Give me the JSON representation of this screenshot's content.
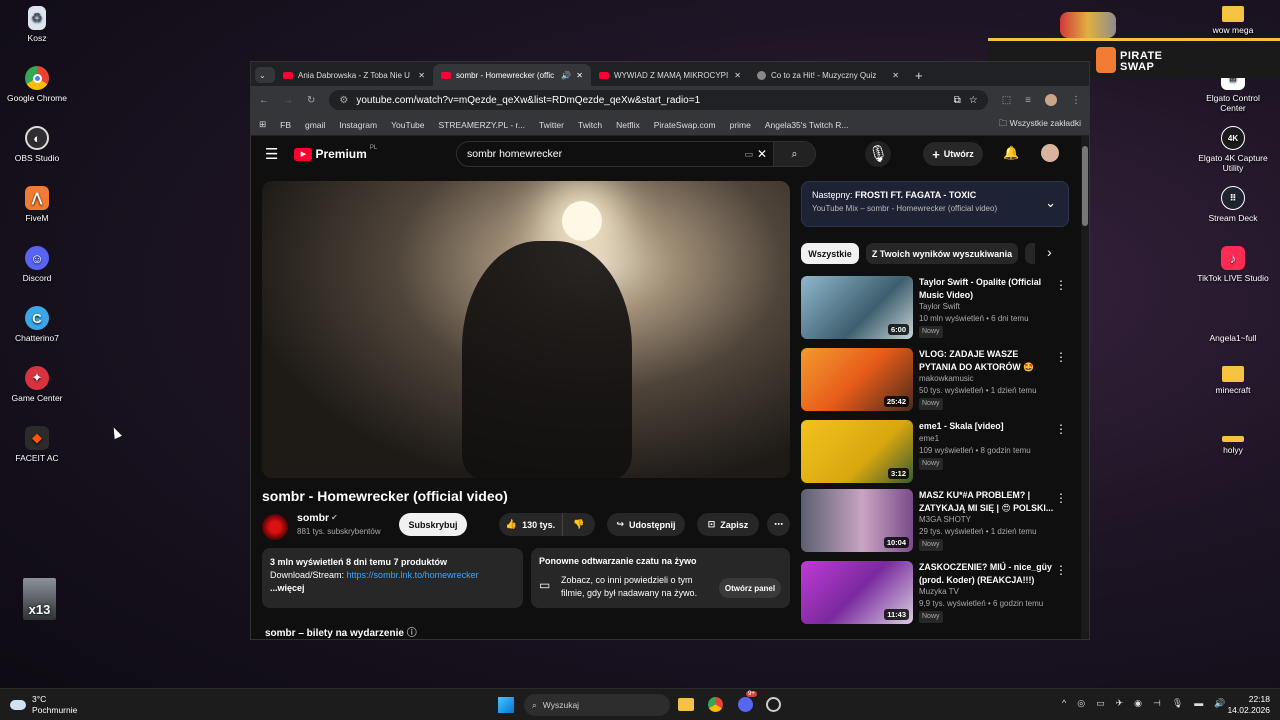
{
  "desktop": {
    "left_icons": [
      {
        "label": "Kosz",
        "icon": "recycle-bin-icon"
      },
      {
        "label": "Google Chrome",
        "icon": "chrome-icon"
      },
      {
        "label": "OBS Studio",
        "icon": "obs-icon"
      },
      {
        "label": "FiveM",
        "icon": "fivem-icon"
      },
      {
        "label": "Discord",
        "icon": "discord-icon"
      },
      {
        "label": "Chatterino7",
        "icon": "chatterino-icon"
      },
      {
        "label": "Game Center",
        "icon": "game-center-icon"
      },
      {
        "label": "FACEIT AC",
        "icon": "faceit-icon"
      }
    ],
    "right_icons": [
      {
        "label": "wow mega",
        "icon": "folder-icon"
      },
      {
        "label": "Elgato Control Center",
        "icon": "elgato-icon"
      },
      {
        "label": "Elgato 4K Capture Utility",
        "icon": "elgato-4k-icon"
      },
      {
        "label": "Stream Deck",
        "icon": "stream-deck-icon"
      },
      {
        "label": "TikTok LIVE Studio",
        "icon": "tiktok-icon"
      },
      {
        "label": "Angela1~full",
        "icon": "file-icon"
      },
      {
        "label": "minecraft",
        "icon": "folder-icon"
      },
      {
        "label": "holyy",
        "icon": "folder-icon"
      }
    ],
    "overlay_logo": "PIRATE SWAP",
    "sticker_text": "x13"
  },
  "browser": {
    "tabs": [
      {
        "title": "Ania Dabrowska - Z Toba Nie U",
        "active": false
      },
      {
        "title": "sombr - Homewrecker (offic",
        "active": true
      },
      {
        "title": "WYWIAD Z MAMĄ MIKROCYPI",
        "active": false
      },
      {
        "title": "Co to za Hit! - Muzyczny Quiz",
        "active": false
      }
    ],
    "url": "youtube.com/watch?v=mQezde_qeXw&list=RDmQezde_qeXw&start_radio=1",
    "bookmarks": [
      "FB",
      "gmail",
      "Instagram",
      "YouTube",
      "STREAMERZY.PL - r...",
      "Twitter",
      "Twitch",
      "Netflix",
      "PirateSwap.com",
      "prime",
      "Angela35's Twitch R...",
      "Wszystkie zakładki"
    ]
  },
  "youtube": {
    "logo_text": "Premium",
    "logo_region": "PL",
    "search_query": "sombr homewrecker",
    "create_label": "Utwórz",
    "video": {
      "title": "sombr - Homewrecker (official video)",
      "channel": "sombr",
      "subscribers": "881 tys. subskrybentów",
      "subscribe_label": "Subskrybuj",
      "likes": "130 tys.",
      "share_label": "Udostępnij",
      "save_label": "Zapisz",
      "stats": "3 mln wyświetleń  8 dni temu  7 produktów",
      "desc_prefix": "Download/Stream: ",
      "desc_link": "https://sombr.lnk.to/homewrecker",
      "more_label": "...więcej",
      "chat_title": "Ponowne odtwarzanie czatu na żywo",
      "chat_text": "Zobacz, co inni powiedzieli o tym filmie, gdy był nadawany na żywo.",
      "chat_button": "Otwórz panel",
      "tickets": "sombr – bilety na wydarzenie"
    },
    "next_box": {
      "label": "Następny:",
      "title": "FROSTI FT. FAGATA - TOXIC",
      "subtitle": "YouTube Mix – sombr - Homewrecker (official video)"
    },
    "chips": [
      "Wszystkie",
      "Z Twoich wyników wyszukiwania"
    ],
    "related": [
      {
        "title": "Taylor Swift - Opalite (Official Music Video)",
        "channel": "Taylor Swift",
        "meta": "10 mln wyświetleń • 6 dni temu",
        "badge": "Nowy",
        "duration": "6:00"
      },
      {
        "title": "VLOG: ZADAJE WASZE PYTANIA DO AKTORÓW 🤩",
        "channel": "makowkamusic",
        "meta": "50 tys. wyświetleń • 1 dzień temu",
        "badge": "Nowy",
        "duration": "25:42"
      },
      {
        "title": "eme1 - Skala [video]",
        "channel": "eme1",
        "meta": "109 wyświetleń • 8 godzin temu",
        "badge": "Nowy",
        "duration": "3:12"
      },
      {
        "title": "MASZ KU*#A PROBLEM? | ZATYKAJĄ MI SIĘ | 😍 POLSKI...",
        "channel": "M3GA SHOTY",
        "meta": "29 tys. wyświetleń • 1 dzień temu",
        "badge": "Nowy",
        "duration": "10:04"
      },
      {
        "title": "ZASKOCZENIE? MIÚ - nice_güy (prod. Koder) (REAKCJA!!!)",
        "channel": "Muzyka TV",
        "meta": "9,9 tys. wyświetleń • 6 godzin temu",
        "badge": "Nowy",
        "duration": "11:43"
      }
    ]
  },
  "taskbar": {
    "weather_temp": "3°C",
    "weather_text": "Pochmurnie",
    "search_placeholder": "Wyszukaj",
    "time": "22:18",
    "date": "14.02.2026",
    "discord_badge": "9+"
  }
}
